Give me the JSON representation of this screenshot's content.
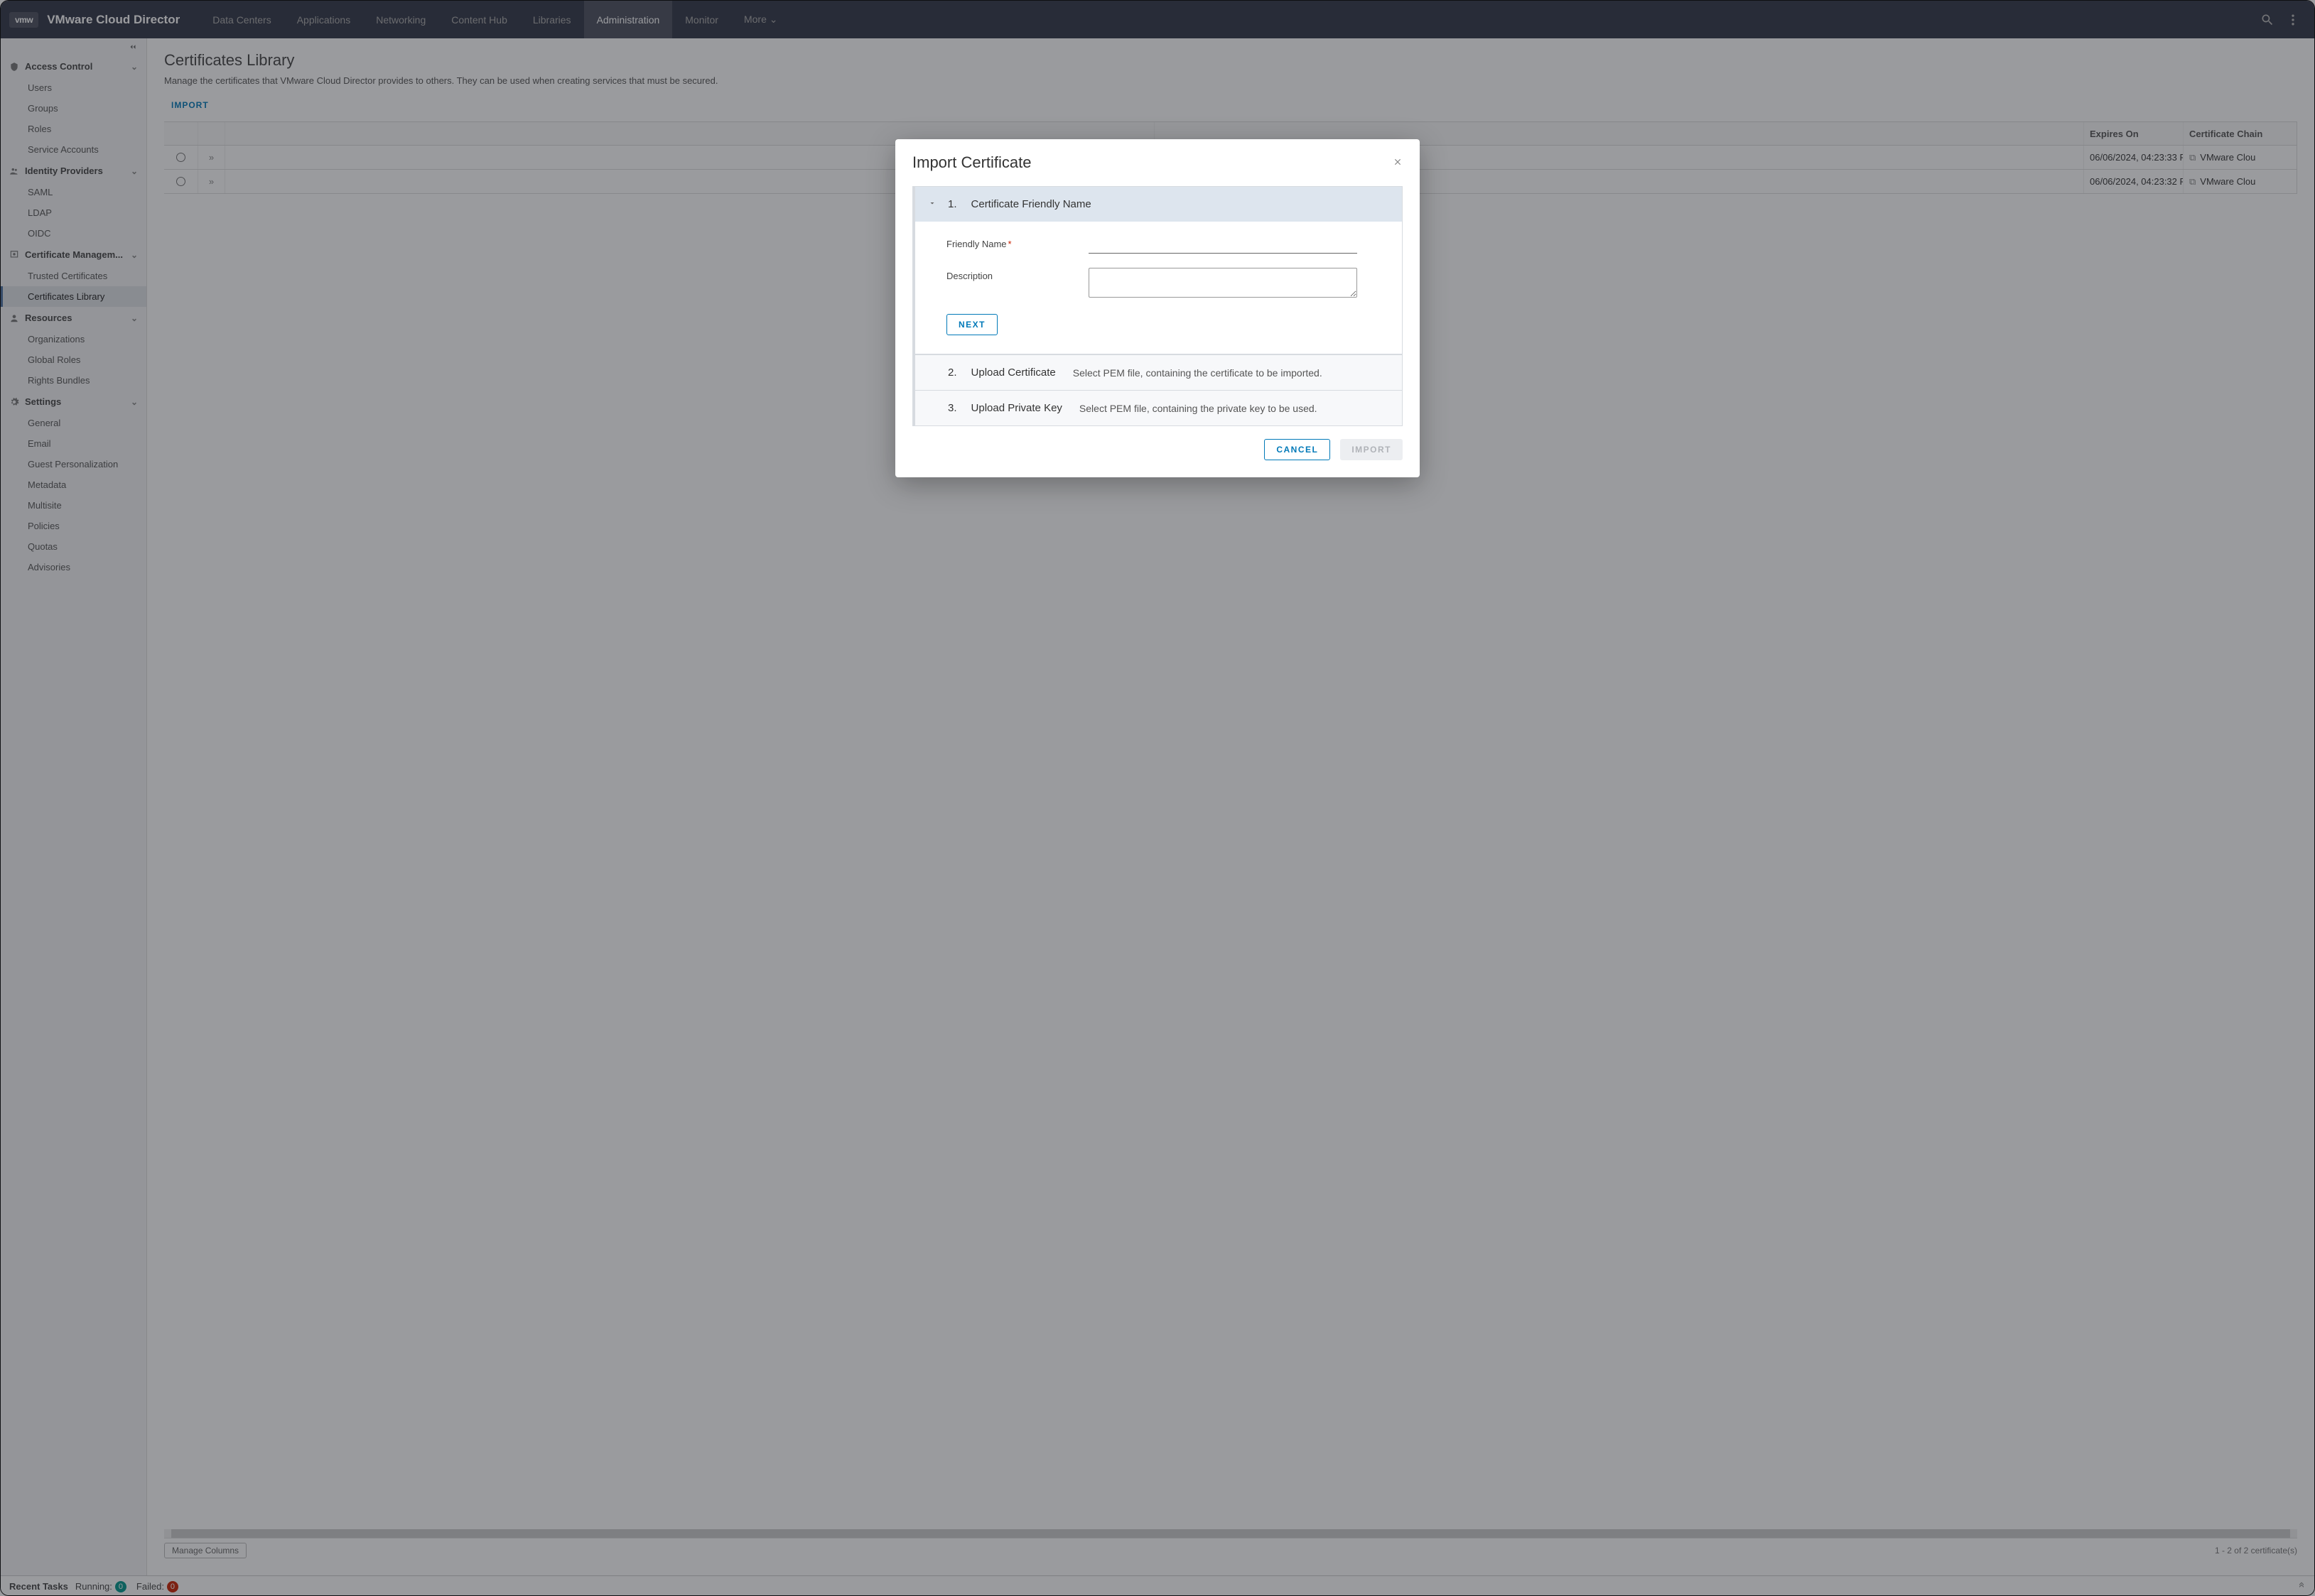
{
  "header": {
    "logo": "vmw",
    "brand": "VMware Cloud Director",
    "nav": [
      "Data Centers",
      "Applications",
      "Networking",
      "Content Hub",
      "Libraries",
      "Administration",
      "Monitor",
      "More"
    ],
    "more_suffix": " ⌄",
    "active_nav": "Administration"
  },
  "sidebar": {
    "groups": [
      {
        "icon": "shield",
        "label": "Access Control",
        "items": [
          "Users",
          "Groups",
          "Roles",
          "Service Accounts"
        ]
      },
      {
        "icon": "users",
        "label": "Identity Providers",
        "items": [
          "SAML",
          "LDAP",
          "OIDC"
        ]
      },
      {
        "icon": "cert",
        "label": "Certificate Managem...",
        "items": [
          "Trusted Certificates",
          "Certificates Library"
        ]
      },
      {
        "icon": "user",
        "label": "Resources",
        "items": [
          "Organizations",
          "Global Roles",
          "Rights Bundles"
        ]
      },
      {
        "icon": "gear",
        "label": "Settings",
        "items": [
          "General",
          "Email",
          "Guest Personalization",
          "Metadata",
          "Multisite",
          "Policies",
          "Quotas",
          "Advisories"
        ]
      }
    ],
    "active_item": "Certificates Library"
  },
  "page": {
    "title": "Certificates Library",
    "description": "Manage the certificates that VMware Cloud Director provides to others. They can be used when creating services that must be secured.",
    "import_action": "IMPORT"
  },
  "grid": {
    "columns": [
      "",
      "",
      "",
      "",
      "Expires On",
      "Certificate Chain"
    ],
    "rows": [
      {
        "expires": "06/06/2024, 04:23:33 P",
        "chain": "VMware Clou"
      },
      {
        "expires": "06/06/2024, 04:23:32 P",
        "chain": "VMware Clou"
      }
    ],
    "manage_columns": "Manage Columns",
    "pagination": "1 - 2 of 2 certificate(s)"
  },
  "statusbar": {
    "label": "Recent Tasks",
    "running_label": "Running:",
    "running_count": "0",
    "failed_label": "Failed:",
    "failed_count": "0"
  },
  "modal": {
    "title": "Import Certificate",
    "steps": [
      {
        "num": "1.",
        "title": "Certificate Friendly Name"
      },
      {
        "num": "2.",
        "title": "Upload Certificate",
        "hint": "Select PEM file, containing the certificate to be imported."
      },
      {
        "num": "3.",
        "title": "Upload Private Key",
        "hint": "Select PEM file, containing the private key to be used."
      }
    ],
    "form": {
      "friendly_name_label": "Friendly Name",
      "friendly_name_value": "",
      "description_label": "Description",
      "description_value": ""
    },
    "next_btn": "NEXT",
    "cancel_btn": "CANCEL",
    "import_btn": "IMPORT"
  }
}
